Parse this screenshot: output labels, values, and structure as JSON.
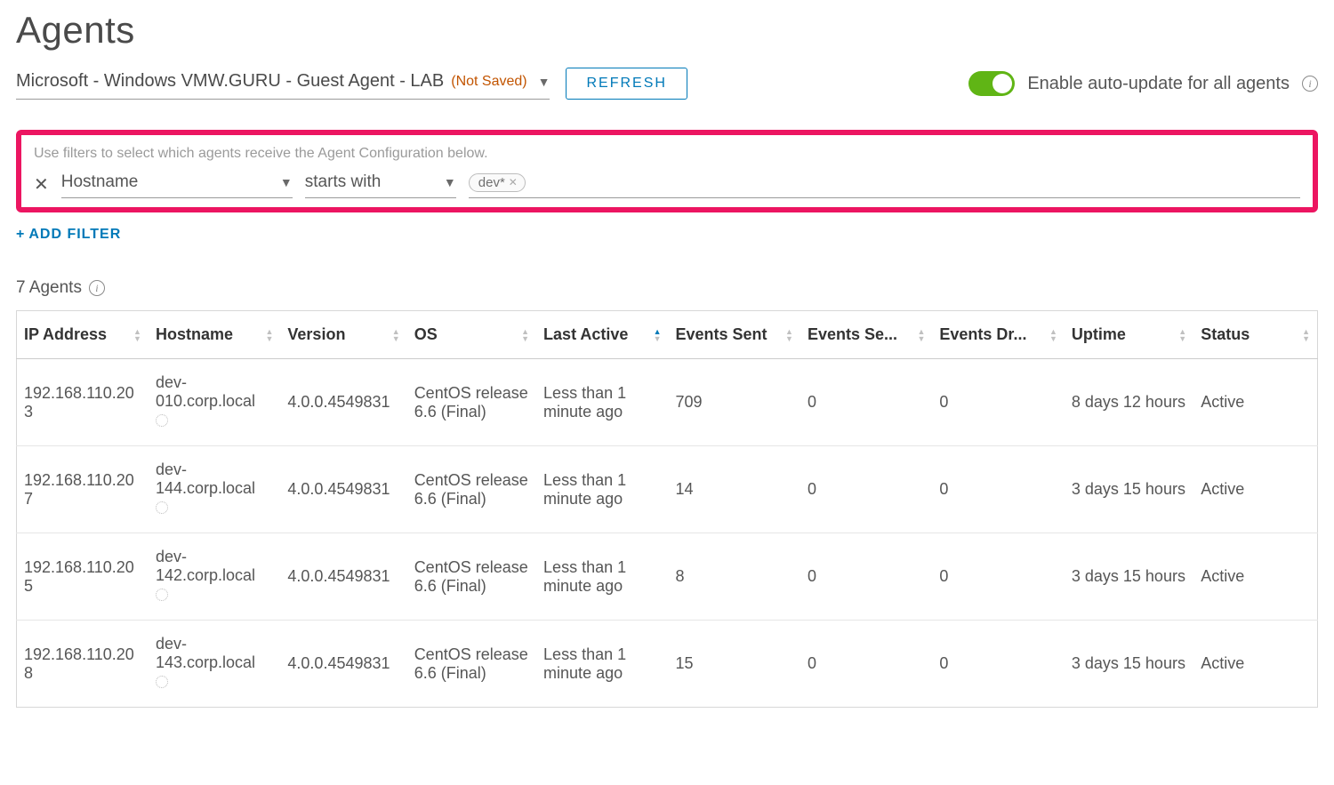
{
  "title": "Agents",
  "config_selector": {
    "label": "Microsoft - Windows VMW.GURU - Guest Agent - LAB",
    "badge": "(Not Saved)"
  },
  "refresh_label": "REFRESH",
  "auto_update": {
    "label": "Enable auto-update for all agents",
    "enabled": true
  },
  "filter_hint": "Use filters to select which agents receive the Agent Configuration below.",
  "filter": {
    "field": "Hostname",
    "operator": "starts with",
    "chip": "dev*"
  },
  "add_filter_label": "ADD FILTER",
  "count_label": "7 Agents",
  "columns": [
    "IP Address",
    "Hostname",
    "Version",
    "OS",
    "Last Active",
    "Events Sent",
    "Events Se...",
    "Events Dr...",
    "Uptime",
    "Status"
  ],
  "sort_column_index": 4,
  "sort_dir": "asc",
  "rows": [
    {
      "ip": "192.168.110.203",
      "host": "dev-010.corp.local",
      "ver": "4.0.0.4549831",
      "os": "CentOS release 6.6 (Final)",
      "last": "Less than 1 minute ago",
      "sent": "709",
      "se2": "0",
      "dr": "0",
      "up": "8 days 12 hours",
      "status": "Active"
    },
    {
      "ip": "192.168.110.207",
      "host": "dev-144.corp.local",
      "ver": "4.0.0.4549831",
      "os": "CentOS release 6.6 (Final)",
      "last": "Less than 1 minute ago",
      "sent": "14",
      "se2": "0",
      "dr": "0",
      "up": "3 days 15 hours",
      "status": "Active"
    },
    {
      "ip": "192.168.110.205",
      "host": "dev-142.corp.local",
      "ver": "4.0.0.4549831",
      "os": "CentOS release 6.6 (Final)",
      "last": "Less than 1 minute ago",
      "sent": "8",
      "se2": "0",
      "dr": "0",
      "up": "3 days 15 hours",
      "status": "Active"
    },
    {
      "ip": "192.168.110.208",
      "host": "dev-143.corp.local",
      "ver": "4.0.0.4549831",
      "os": "CentOS release 6.6 (Final)",
      "last": "Less than 1 minute ago",
      "sent": "15",
      "se2": "0",
      "dr": "0",
      "up": "3 days 15 hours",
      "status": "Active"
    }
  ]
}
